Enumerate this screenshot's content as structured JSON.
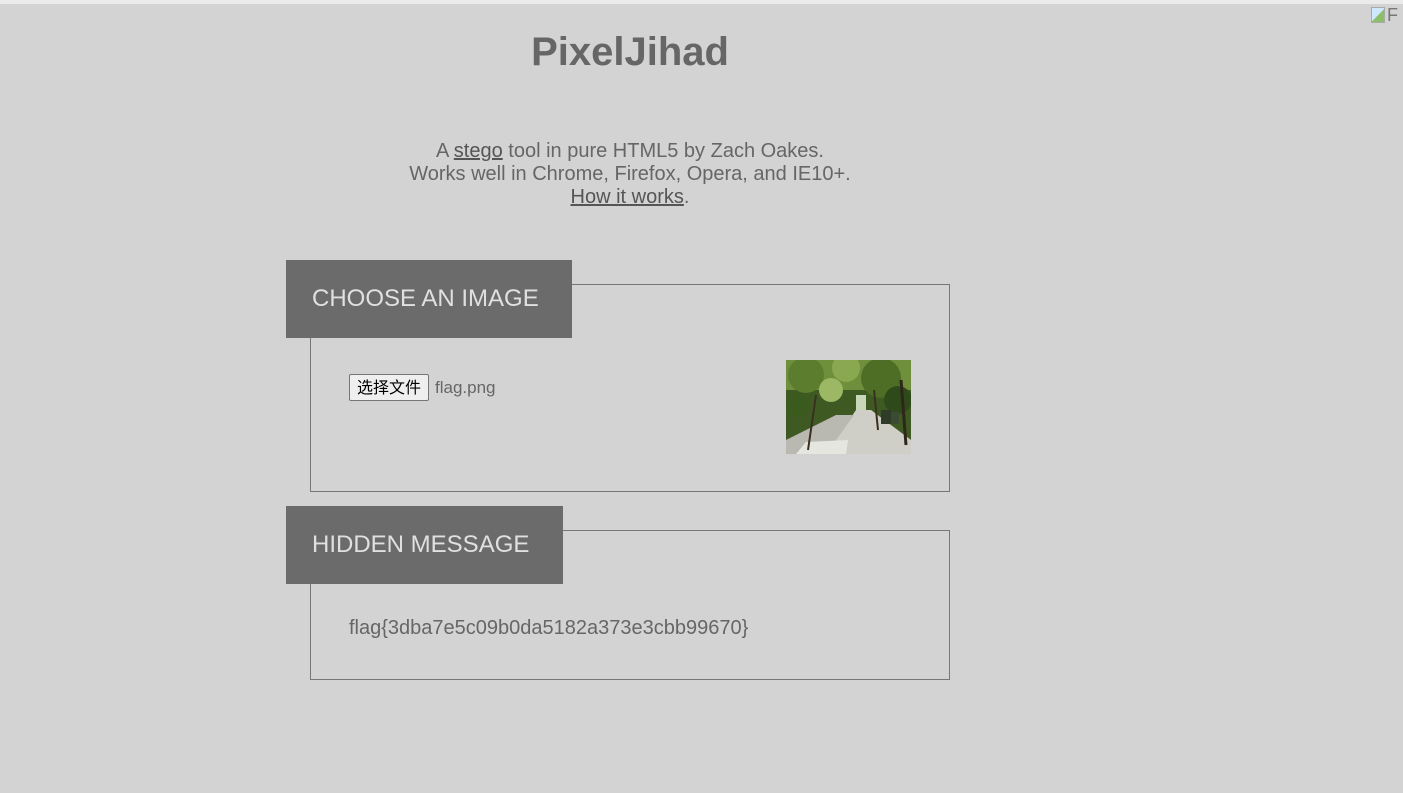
{
  "header": {
    "title": "PixelJihad",
    "broken_image_alt": "F"
  },
  "description": {
    "line1_prefix": "A ",
    "line1_link": "stego",
    "line1_suffix": " tool in pure HTML5 by Zach Oakes.",
    "line2": "Works well in Chrome, Firefox, Opera, and IE10+.",
    "line3_link": "How it works",
    "line3_suffix": "."
  },
  "choose_image": {
    "label": "CHOOSE AN IMAGE",
    "file_button_label": "选择文件",
    "file_name": "flag.png",
    "preview_icon": "image-preview"
  },
  "hidden_message": {
    "label": "HIDDEN MESSAGE",
    "text": "flag{3dba7e5c09b0da5182a373e3cbb99670}"
  },
  "colors": {
    "background": "#d3d3d3",
    "label_background": "#6b6b6b",
    "label_text": "#e0e0e0",
    "text": "#666666"
  }
}
